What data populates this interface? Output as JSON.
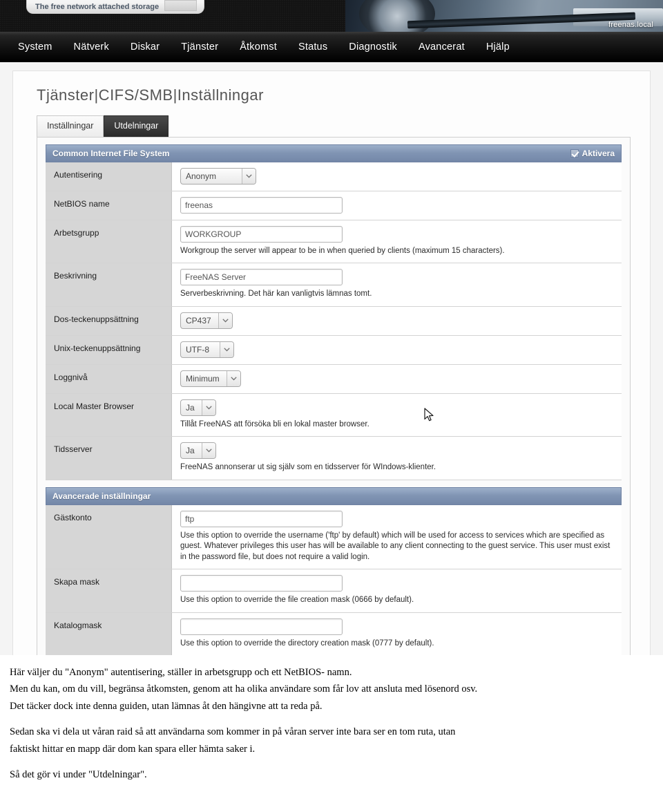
{
  "banner": {
    "logo_tagline": "The free network attached storage",
    "hostname": "freenas.local"
  },
  "nav": {
    "items": [
      {
        "label": "System"
      },
      {
        "label": "Nätverk"
      },
      {
        "label": "Diskar"
      },
      {
        "label": "Tjänster"
      },
      {
        "label": "Åtkomst"
      },
      {
        "label": "Status"
      },
      {
        "label": "Diagnostik"
      },
      {
        "label": "Avancerat"
      },
      {
        "label": "Hjälp"
      }
    ]
  },
  "page": {
    "title": "Tjänster|CIFS/SMB|Inställningar",
    "tabs": [
      {
        "label": "Inställningar",
        "active": true
      },
      {
        "label": "Utdelningar",
        "active": false
      }
    ]
  },
  "cifs_section": {
    "title": "Common Internet File System",
    "enable_label": "Aktivera",
    "enabled": true,
    "rows": {
      "auth": {
        "label": "Autentisering",
        "value": "Anonym"
      },
      "netbios": {
        "label": "NetBIOS name",
        "value": "freenas"
      },
      "workgroup": {
        "label": "Arbetsgrupp",
        "value": "WORKGROUP",
        "hint": "Workgroup the server will appear to be in when queried by clients (maximum 15 characters)."
      },
      "description": {
        "label": "Beskrivning",
        "value": "FreeNAS Server",
        "hint": "Serverbeskrivning. Det här kan vanligtvis lämnas tomt."
      },
      "dos_charset": {
        "label": "Dos-teckenuppsättning",
        "value": "CP437"
      },
      "unix_charset": {
        "label": "Unix-teckenuppsättning",
        "value": "UTF-8"
      },
      "loglevel": {
        "label": "Loggnivå",
        "value": "Minimum"
      },
      "local_master_browser": {
        "label": "Local Master Browser",
        "value": "Ja",
        "hint": "Tillåt FreeNAS att försöka bli en lokal master browser."
      },
      "time_server": {
        "label": "Tidsserver",
        "value": "Ja",
        "hint": "FreeNAS annonserar ut sig själv som en tidsserver för WIndows-klienter."
      }
    }
  },
  "advanced_section": {
    "title": "Avancerade inställningar",
    "rows": {
      "guest_account": {
        "label": "Gästkonto",
        "value": "ftp",
        "hint": "Use this option to override the username ('ftp' by default) which will be used for access to services which are specified as guest. Whatever privileges this user has will be available to any client connecting to the guest service. This user must exist in the password file, but does not require a valid login."
      },
      "create_mask": {
        "label": "Skapa mask",
        "value": "",
        "hint": "Use this option to override the file creation mask (0666 by default)."
      },
      "directory_mask": {
        "label": "Katalogmask",
        "value": "",
        "hint": "Use this option to override the directory creation mask (0777 by default)."
      }
    }
  },
  "prose": {
    "p1": "Här väljer du \"Anonym\" autentisering, ställer in arbetsgrupp och ett NetBIOS- namn.",
    "p2": "Men du kan, om du vill, begränsa åtkomsten, genom att ha olika användare som får lov att ansluta med lösenord osv.",
    "p3": "Det täcker dock inte denna guiden, utan lämnas åt den hängivne att ta reda på.",
    "p4": "Sedan ska vi dela ut våran raid så att användarna som kommer in på våran server inte bara ser en tom ruta, utan",
    "p5": "faktiskt hittar en mapp där dom kan spara eller hämta saker i.",
    "p6": "Så det gör vi under \"Utdelningar\"."
  }
}
